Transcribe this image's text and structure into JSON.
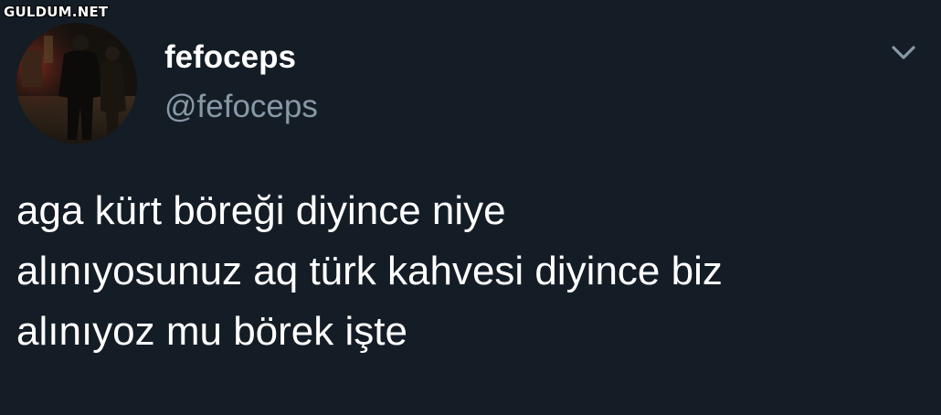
{
  "watermark": "GULDUM.NET",
  "tweet": {
    "display_name": "fefoceps",
    "handle": "@fefoceps",
    "text_lines": [
      "aga kürt böreği diyince niye",
      "alınıyosunuz aq türk kahvesi diyince biz",
      "alınıyoz mu börek işte"
    ]
  },
  "icons": {
    "menu": "chevron-down-icon",
    "avatar": "profile-photo"
  },
  "colors": {
    "background": "#141d26",
    "primary_text": "#ffffff",
    "secondary_text": "#8899a6"
  }
}
